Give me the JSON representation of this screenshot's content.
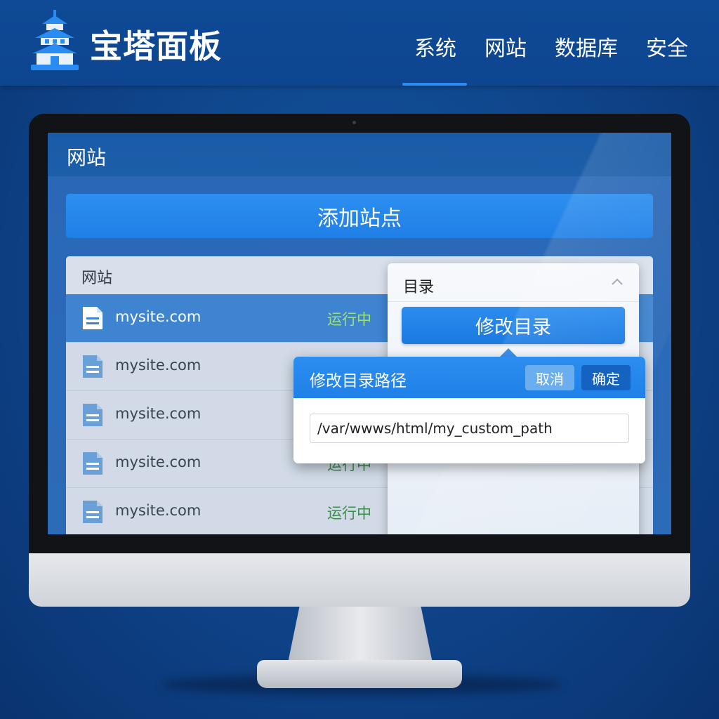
{
  "header": {
    "brand": "宝塔面板",
    "nav": [
      "系统",
      "网站",
      "数据库",
      "安全"
    ],
    "active_nav": "网站"
  },
  "screen": {
    "title": "网站",
    "add_site_label": "添加站点",
    "list_header": "网站",
    "sites": [
      {
        "name": "mysite.com",
        "status": "运行中",
        "selected": true
      },
      {
        "name": "mysite.com",
        "status": "",
        "selected": false
      },
      {
        "name": "mysite.com",
        "status": "",
        "selected": false
      },
      {
        "name": "mysite.com",
        "status": "运行中",
        "selected": false
      },
      {
        "name": "mysite.com",
        "status": "运行中",
        "selected": false
      }
    ],
    "directory_panel": {
      "label": "目录",
      "modify_button": "修改目录"
    }
  },
  "dialog": {
    "title": "修改目录路径",
    "cancel_label": "取消",
    "confirm_label": "确定",
    "path_value": "/var/wwws/html/my_custom_path"
  },
  "colors": {
    "background": "#0e4388",
    "accent": "#1f80e8",
    "status_green": "#3b8c4f"
  },
  "icons": [
    "pagoda-logo-icon",
    "file-icon",
    "chevron-up-icon"
  ]
}
